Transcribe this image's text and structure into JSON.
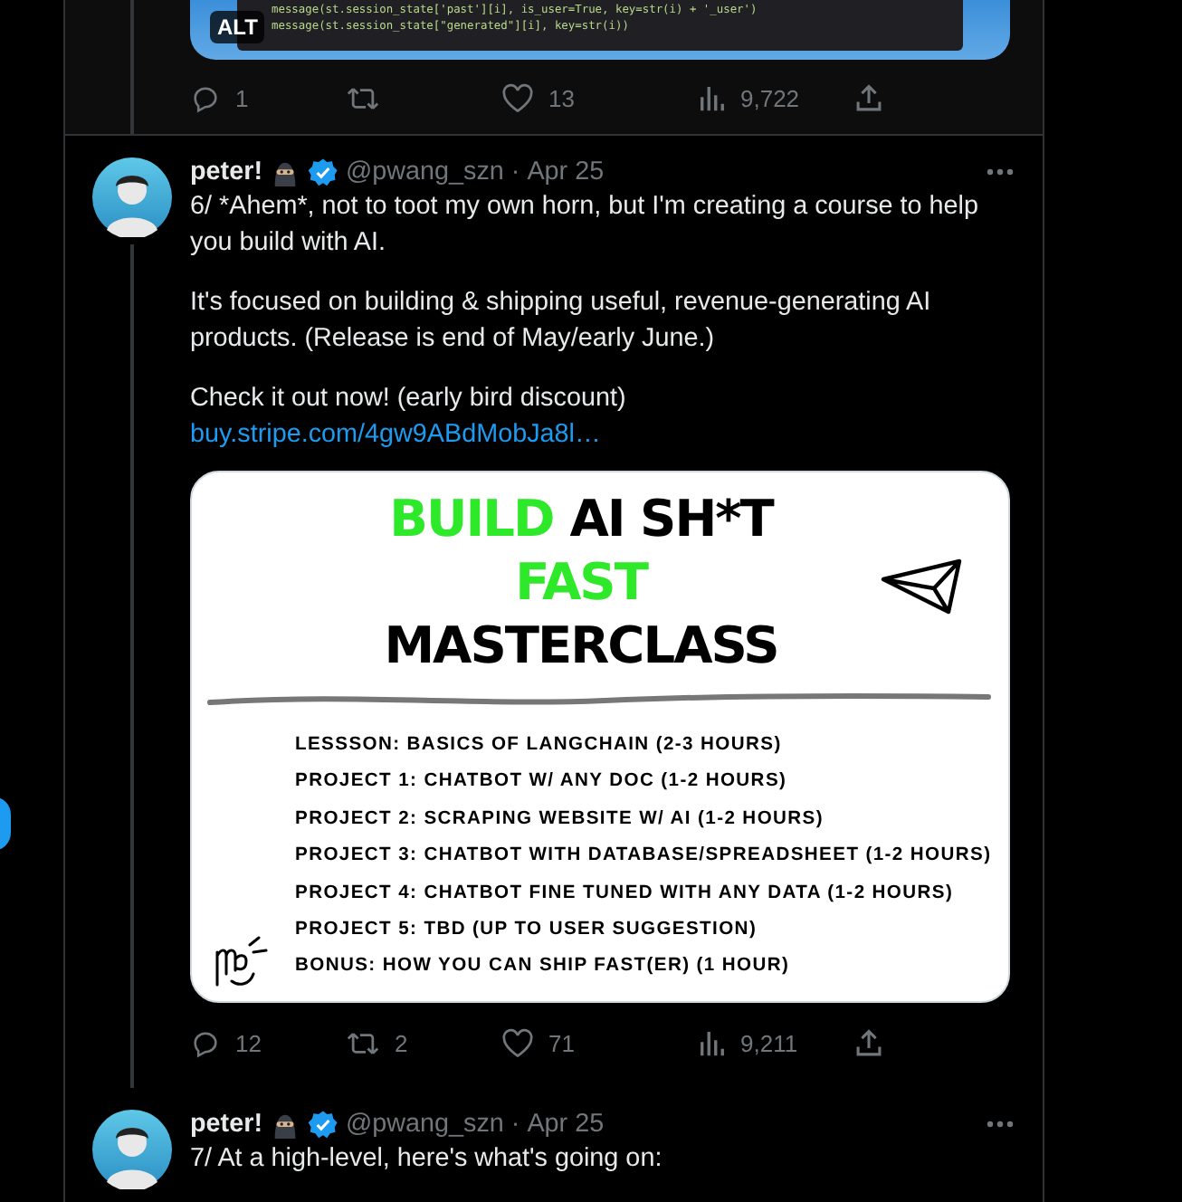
{
  "previous_tweet": {
    "connected": true,
    "media": {
      "badge": "ALT",
      "code_lines": [
        "message(st.session_state['past'][i], is_user=True, key=str(i) + '_user')",
        "message(st.session_state[\"generated\"][i], key=str(i))"
      ]
    },
    "actions": {
      "replies": "1",
      "likes": "13",
      "views": "9,722"
    }
  },
  "tweets": [
    {
      "connected": true,
      "author": "peter!",
      "verified": true,
      "handle": "@pwang_szn",
      "separator": "·",
      "date": "Apr 25",
      "paragraphs": [
        "6/ *Ahem*, not to toot my own horn, but I'm creating a course to help you build with AI.",
        "It's focused on building & shipping useful, revenue-generating AI products. (Release is end of May/early June.)",
        "Check it out now! (early bird discount)"
      ],
      "link": "buy.stripe.com/4gw9ABdMobJa8l…",
      "card": {
        "title_lines": [
          [
            {
              "text": "BUILD",
              "highlight": true
            },
            {
              "text": "AI SH*T",
              "highlight": false
            }
          ],
          [
            {
              "text": "FAST",
              "highlight": true
            }
          ],
          [
            {
              "text": "MASTERCLASS",
              "highlight": false
            }
          ]
        ],
        "items": [
          "LESSSON: BASICS OF LANGCHAIN (2-3 HOURS)",
          "PROJECT 1: CHATBOT W/ ANY DOC (1-2 HOURS)",
          "PROJECT 2: SCRAPING WEBSITE W/ AI (1-2 HOURS)",
          "PROJECT 3: CHATBOT WITH DATABASE/SPREADSHEET (1-2 HOURS)",
          "PROJECT 4: CHATBOT FINE TUNED WITH ANY DATA (1-2 HOURS)",
          "PROJECT 5: TBD (UP TO USER SUGGESTION)",
          "BONUS: HOW YOU CAN SHIP FAST(ER) (1 HOUR)"
        ]
      },
      "actions": {
        "replies": "12",
        "retweets": "2",
        "likes": "71",
        "views": "9,211"
      }
    },
    {
      "connected": false,
      "author": "peter!",
      "verified": true,
      "handle": "@pwang_szn",
      "separator": "·",
      "date": "Apr 25",
      "paragraphs": [
        "7/ At a high-level, here's what's going on:"
      ]
    }
  ]
}
